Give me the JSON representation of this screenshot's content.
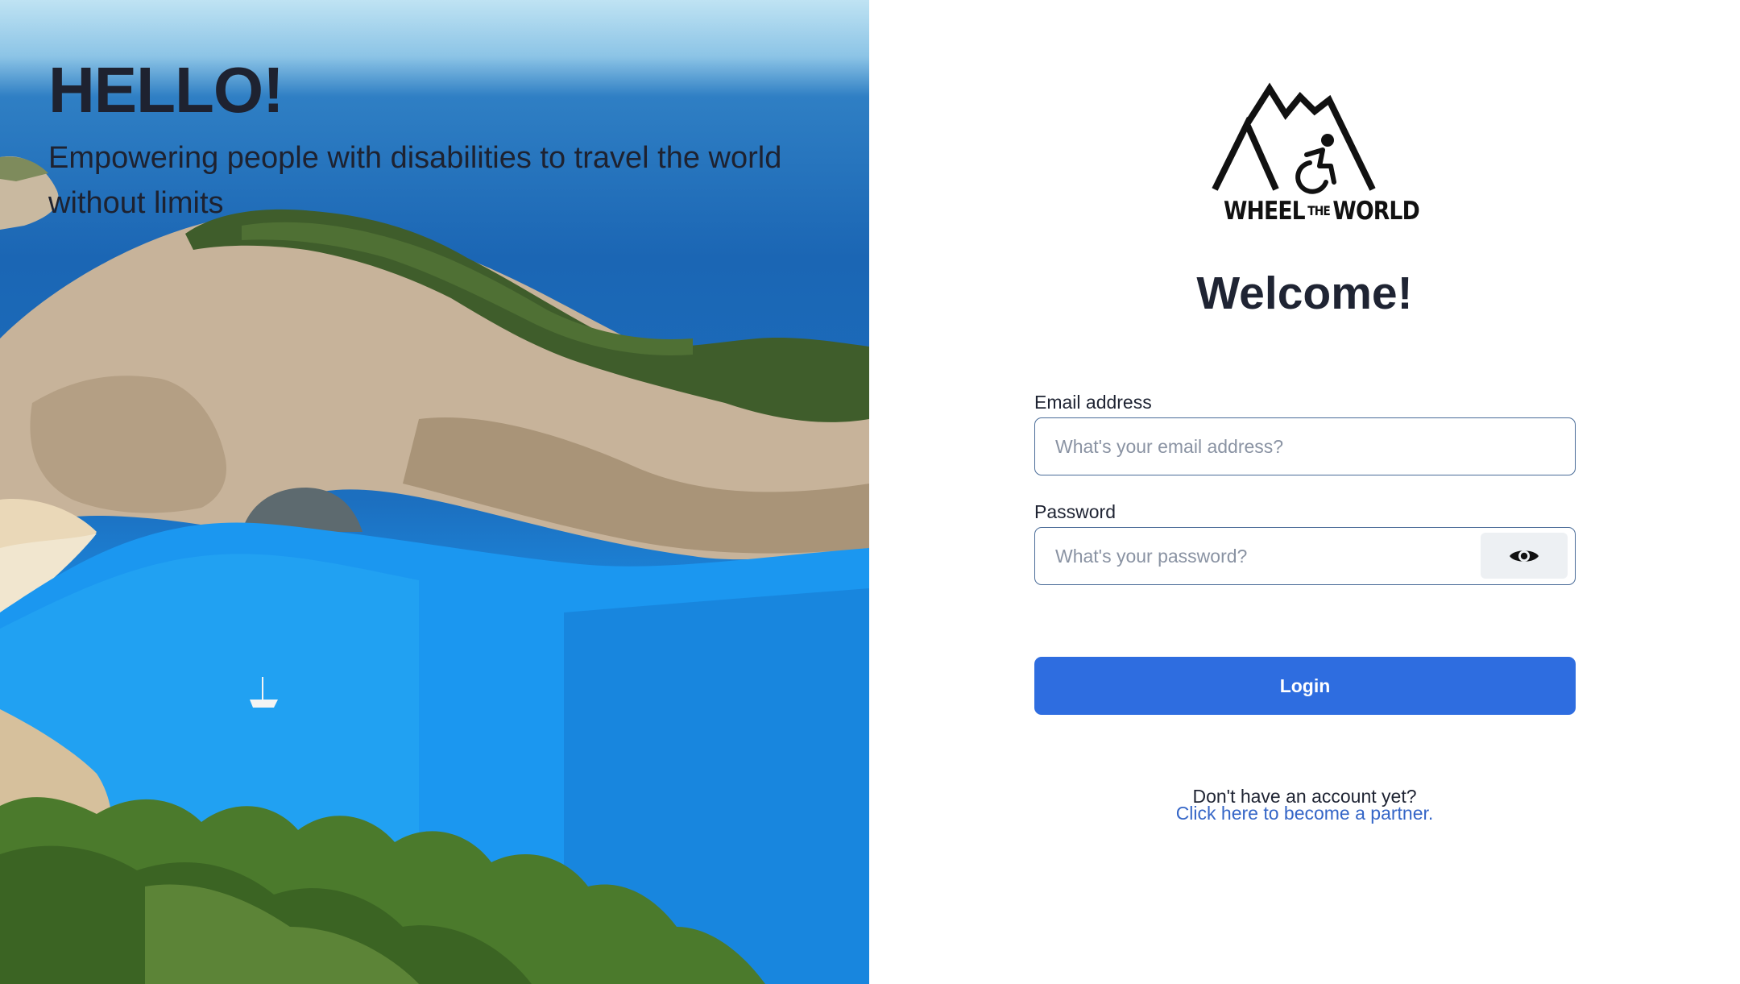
{
  "hero": {
    "title": "HELLO!",
    "subtitle": "Empowering people with disabilities to travel the world without limits"
  },
  "brand": {
    "logo_word_1": "WHEEL",
    "logo_word_2": "THE",
    "logo_word_3": "WORLD",
    "icons": [
      "mountains-icon",
      "wheelchair-icon"
    ]
  },
  "login": {
    "heading": "Welcome!",
    "email_label": "Email address",
    "email_placeholder": "What's your email address?",
    "password_label": "Password",
    "password_placeholder": "What's your password?",
    "show_password_icon": "eye-icon",
    "submit_label": "Login",
    "signup_prompt": "Don't have an account yet?",
    "signup_link": "Click here to become a partner."
  },
  "colors": {
    "primary": "#2e6de0",
    "link": "#3566c7",
    "text": "#1f2433",
    "input_border": "#4a6c98",
    "eye_button_bg": "#edf0f3"
  }
}
